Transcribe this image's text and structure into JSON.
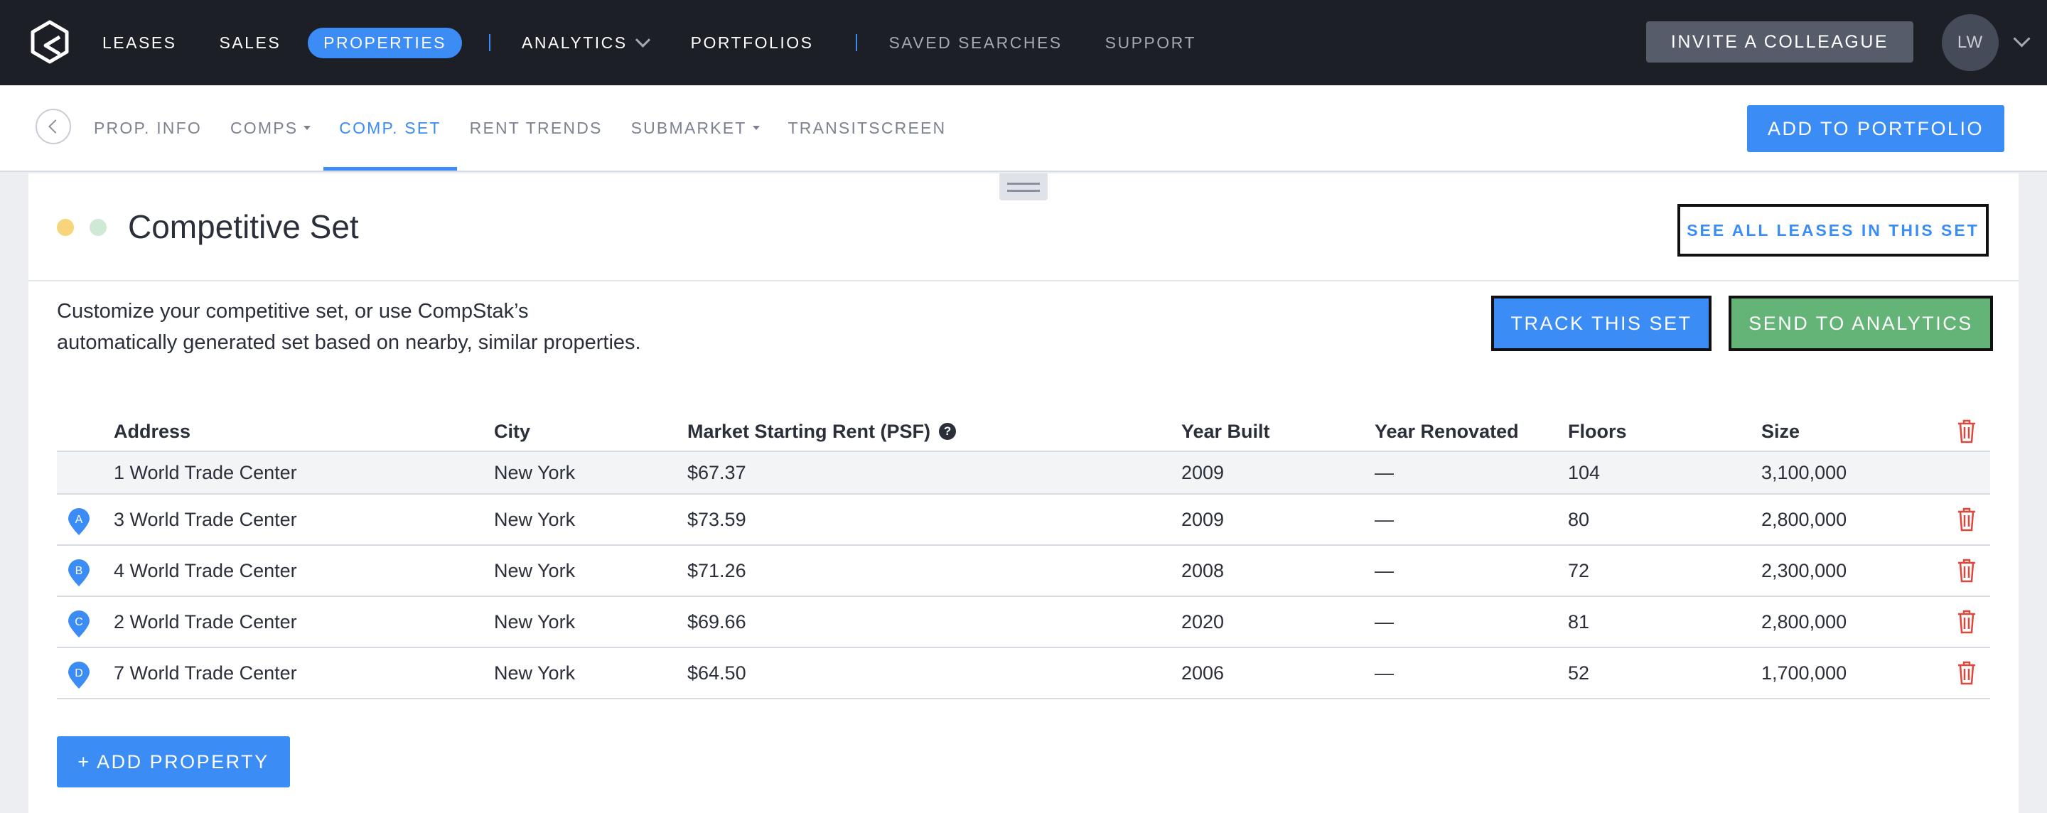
{
  "topnav": {
    "logo": "compstak-logo",
    "items": [
      {
        "label": "LEASES"
      },
      {
        "label": "SALES"
      },
      {
        "label": "PROPERTIES"
      },
      {
        "label": "ANALYTICS"
      },
      {
        "label": "PORTFOLIOS"
      },
      {
        "label": "SAVED SEARCHES"
      },
      {
        "label": "SUPPORT"
      }
    ],
    "invite_label": "INVITE A COLLEAGUE",
    "avatar_initials": "LW"
  },
  "subnav": {
    "tabs": [
      {
        "label": "PROP. INFO"
      },
      {
        "label": "COMPS"
      },
      {
        "label": "COMP. SET"
      },
      {
        "label": "RENT TRENDS"
      },
      {
        "label": "SUBMARKET"
      },
      {
        "label": "TRANSITSCREEN"
      }
    ],
    "active_tab": "COMP. SET",
    "add_to_portfolio_label": "ADD TO PORTFOLIO"
  },
  "card": {
    "title": "Competitive Set",
    "see_all_label": "SEE ALL LEASES IN THIS SET",
    "description_line1": "Customize your competitive set, or use CompStak’s",
    "description_line2": "automatically generated set based on nearby, similar properties.",
    "track_label": "TRACK THIS SET",
    "analytics_label": "SEND TO ANALYTICS",
    "add_property_label": "+ ADD PROPERTY"
  },
  "colors": {
    "accent": "#3b8cf5",
    "green": "#64b377",
    "delete": "#e0463c",
    "dot_yellow": "#f7d57a",
    "dot_green": "#cfe9d6",
    "navbar": "#1c1f26"
  },
  "table": {
    "columns": {
      "address": "Address",
      "city": "City",
      "rent": "Market Starting Rent (PSF)",
      "year_built": "Year Built",
      "year_renovated": "Year Renovated",
      "floors": "Floors",
      "size": "Size"
    },
    "subject": {
      "address": "1 World Trade Center",
      "city": "New York",
      "rent": "$67.37",
      "year_built": "2009",
      "year_renovated": "—",
      "floors": "104",
      "size": "3,100,000"
    },
    "rows": [
      {
        "marker": "A",
        "address": "3 World Trade Center",
        "city": "New York",
        "rent": "$73.59",
        "year_built": "2009",
        "year_renovated": "—",
        "floors": "80",
        "size": "2,800,000"
      },
      {
        "marker": "B",
        "address": "4 World Trade Center",
        "city": "New York",
        "rent": "$71.26",
        "year_built": "2008",
        "year_renovated": "—",
        "floors": "72",
        "size": "2,300,000"
      },
      {
        "marker": "C",
        "address": "2 World Trade Center",
        "city": "New York",
        "rent": "$69.66",
        "year_built": "2020",
        "year_renovated": "—",
        "floors": "81",
        "size": "2,800,000"
      },
      {
        "marker": "D",
        "address": "7 World Trade Center",
        "city": "New York",
        "rent": "$64.50",
        "year_built": "2006",
        "year_renovated": "—",
        "floors": "52",
        "size": "1,700,000"
      }
    ]
  }
}
